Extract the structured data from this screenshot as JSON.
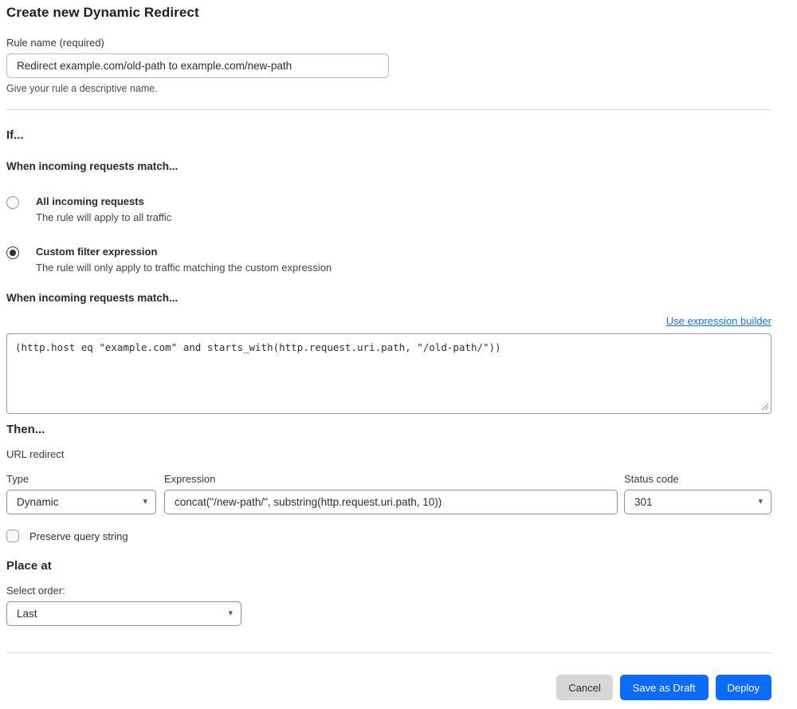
{
  "page": {
    "title": "Create new Dynamic Redirect"
  },
  "rule_name": {
    "label": "Rule name (required)",
    "value": "Redirect example.com/old-path to example.com/new-path",
    "helper": "Give your rule a descriptive name."
  },
  "if_section": {
    "heading": "If...",
    "match_heading": "When incoming requests match...",
    "options": [
      {
        "label": "All incoming requests",
        "description": "The rule will apply to all traffic",
        "selected": false
      },
      {
        "label": "Custom filter expression",
        "description": "The rule will only apply to traffic matching the custom expression",
        "selected": true
      }
    ],
    "expression_heading": "When incoming requests match...",
    "builder_link": "Use expression builder",
    "expression_value": "(http.host eq \"example.com\" and starts_with(http.request.uri.path, \"/old-path/\"))"
  },
  "then_section": {
    "heading": "Then...",
    "action_label": "URL redirect",
    "type": {
      "label": "Type",
      "value": "Dynamic"
    },
    "expression": {
      "label": "Expression",
      "value": "concat(\"/new-path/\", substring(http.request.uri.path, 10))"
    },
    "status_code": {
      "label": "Status code",
      "value": "301"
    },
    "preserve_query": {
      "label": "Preserve query string",
      "checked": false
    }
  },
  "place_at": {
    "heading": "Place at",
    "label": "Select order:",
    "value": "Last"
  },
  "footer": {
    "cancel": "Cancel",
    "save_draft": "Save as Draft",
    "deploy": "Deploy"
  },
  "colors": {
    "primary_blue": "#0b6cfb",
    "link_blue": "#1672ec",
    "divider": "#d6d6d6"
  }
}
